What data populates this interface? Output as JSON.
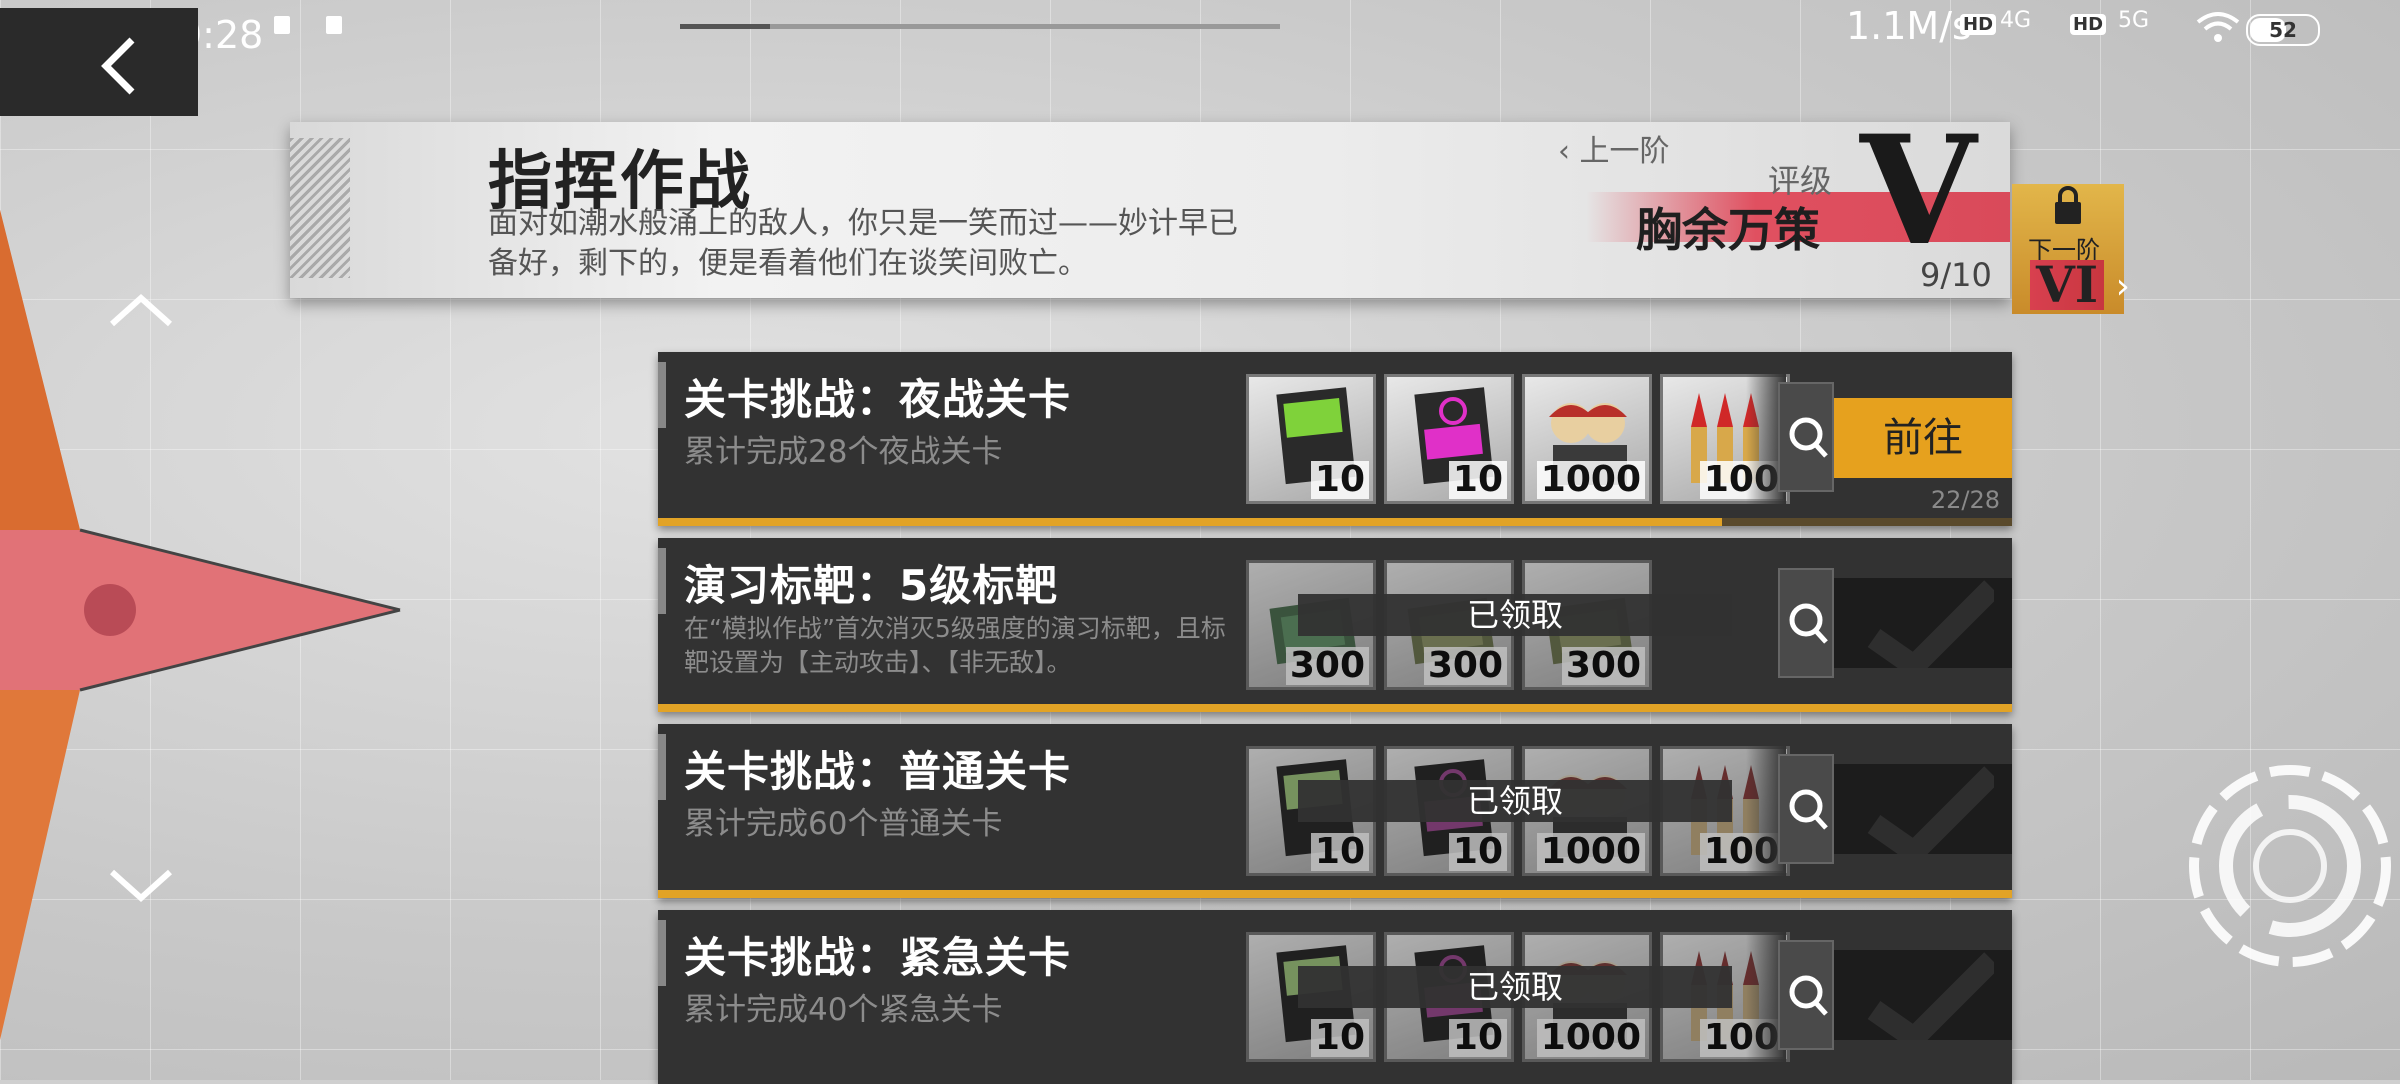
{
  "status_bar": {
    "time": "晚上9:28",
    "net_speed": "1.1M/s",
    "hd1": "HD",
    "sig1": "4G",
    "hd2": "HD",
    "sig2": "5G",
    "battery": "52"
  },
  "header": {
    "title": "指挥作战",
    "description": "面对如潮水般涌上的敌人，你只是一笑而过——妙计早已备好，剩下的，便是看着他们在谈笑间败亡。",
    "prev_tier_label": "上一阶",
    "rating_label": "评级",
    "rating_name": "胸余万策",
    "rating_letter": "V",
    "progress": "9/10",
    "next_tier_label": "下一阶",
    "next_tier_value": "VI"
  },
  "tasks": [
    {
      "title": "关卡挑战：夜战关卡",
      "subtitle": "累计完成28个夜战关卡",
      "rewards": [
        {
          "icon": "green-card-icon",
          "qty": "10"
        },
        {
          "icon": "magenta-card-icon",
          "qty": "10"
        },
        {
          "icon": "chibi-dolls-icon",
          "qty": "1000"
        },
        {
          "icon": "ammo-icon",
          "qty": "100"
        }
      ],
      "button": "前往",
      "count": "22/28",
      "progress": 0.786,
      "claimed": false
    },
    {
      "title": "演习标靶：5级标靶",
      "subtitle": "在“模拟作战”首次消灭5级强度的演习标靶，且标靶设置为【主动攻击】、【非无敌】。",
      "rewards": [
        {
          "icon": "green-chip-icon",
          "qty": "300"
        },
        {
          "icon": "olive-chip-icon",
          "qty": "300"
        },
        {
          "icon": "olive-chip-icon",
          "qty": "300"
        }
      ],
      "claimed_label": "已领取",
      "progress": 1,
      "claimed": true
    },
    {
      "title": "关卡挑战：普通关卡",
      "subtitle": "累计完成60个普通关卡",
      "rewards": [
        {
          "icon": "green-card-icon",
          "qty": "10"
        },
        {
          "icon": "magenta-card-icon",
          "qty": "10"
        },
        {
          "icon": "chibi-dolls-icon",
          "qty": "1000"
        },
        {
          "icon": "ammo-icon",
          "qty": "100"
        }
      ],
      "claimed_label": "已领取",
      "progress": 1,
      "claimed": true
    },
    {
      "title": "关卡挑战：紧急关卡",
      "subtitle": "累计完成40个紧急关卡",
      "rewards": [
        {
          "icon": "green-card-icon",
          "qty": "10"
        },
        {
          "icon": "magenta-card-icon",
          "qty": "10"
        },
        {
          "icon": "chibi-dolls-icon",
          "qty": "1000"
        },
        {
          "icon": "ammo-icon",
          "qty": "100"
        }
      ],
      "claimed_label": "已领取",
      "progress": 1,
      "claimed": true
    }
  ],
  "colors": {
    "accent_orange": "#e6a11e",
    "rating_red": "#e05060",
    "compass_orange": "#e07a3a"
  }
}
